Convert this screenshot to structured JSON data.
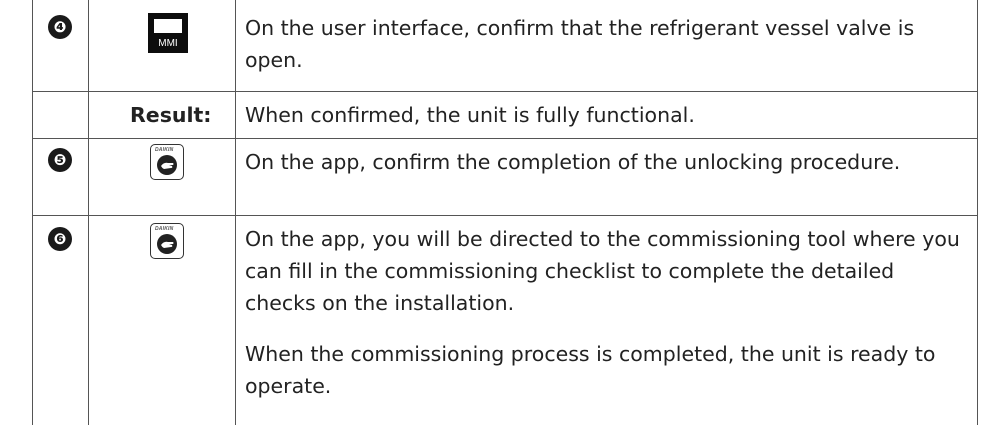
{
  "rows": [
    {
      "step": "❹",
      "icon": "mmi-icon",
      "icon_label": "MMI",
      "text": "On the user interface, confirm that the refrigerant vessel valve is open."
    },
    {
      "label": "Result:",
      "text": "When confirmed, the unit is fully functional."
    },
    {
      "step": "❺",
      "icon": "daikin-app-icon",
      "brand": "DAIKIN",
      "text": "On the app, confirm the completion of the unlocking procedure."
    },
    {
      "step": "❻",
      "icon": "daikin-app-icon",
      "brand": "DAIKIN",
      "text": "On the app, you will be directed to the commissioning tool where you can fill in the commissioning checklist to complete the detailed checks on the installation.",
      "text2": "When the commissioning process is completed, the unit is ready to operate."
    }
  ]
}
